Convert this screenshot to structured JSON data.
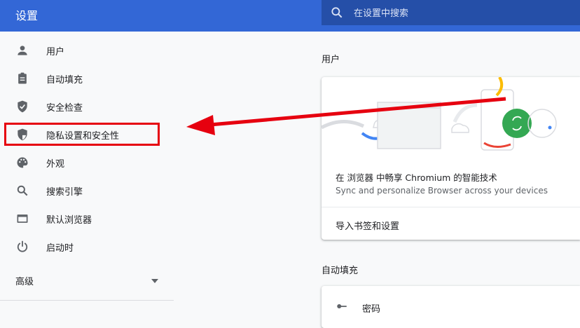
{
  "header": {
    "title": "设置",
    "search_placeholder": "在设置中搜索"
  },
  "sidebar": {
    "items": [
      {
        "label": "用户",
        "icon": "person-icon"
      },
      {
        "label": "自动填充",
        "icon": "clipboard-icon"
      },
      {
        "label": "安全检查",
        "icon": "shield-check-icon"
      },
      {
        "label": "隐私设置和安全性",
        "icon": "privacy-shield-icon"
      },
      {
        "label": "外观",
        "icon": "palette-icon"
      },
      {
        "label": "搜索引擎",
        "icon": "search-icon"
      },
      {
        "label": "默认浏览器",
        "icon": "browser-window-icon"
      },
      {
        "label": "启动时",
        "icon": "power-icon"
      }
    ],
    "advanced_label": "高级"
  },
  "main": {
    "people_section_title": "用户",
    "people_card": {
      "promo_title": "在 浏览器 中畅享 Chromium 的智能技术",
      "promo_subtitle": "Sync and personalize Browser across your devices",
      "import_label": "导入书签和设置"
    },
    "autofill_section_title": "自动填充",
    "autofill_card": {
      "first_row_label": "密码"
    }
  },
  "annotation": {
    "highlight_color": "#e6000f",
    "highlighted_item": "隐私设置和安全性"
  },
  "colors": {
    "header_bg": "#3367d6",
    "search_bg": "#254fa8",
    "page_bg": "#f8f9fa"
  }
}
